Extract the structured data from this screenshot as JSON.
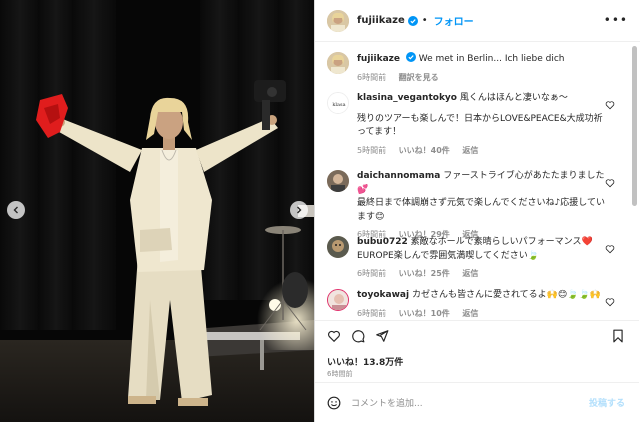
{
  "post": {
    "username": "fujiikaze",
    "separator": "•",
    "follow_label": "フォロー",
    "more_label": "•••",
    "caption": "We met in Berlin... Ich liebe dich",
    "caption_time": "6時間前",
    "see_translation": "翻訳を見る"
  },
  "comments": [
    {
      "username": "klasina_vegantokyo",
      "text_line1": "風くんはほんと凄いなぁ〜",
      "text_rest": "残りのツアーも楽しんで！日本からLOVE&PEACE&大成功祈ってます！",
      "time": "5時間前",
      "likes": "いいね！40件",
      "reply": "返信",
      "avatar_text": "klasa"
    },
    {
      "username": "daichannomama",
      "text_line1": "ファーストライブ心があたたまりました💕",
      "text_rest": "最終日まで体調崩さず元気で楽しんでくださいね♪応援しています😊",
      "time": "6時間前",
      "likes": "いいね！29件",
      "reply": "返信"
    },
    {
      "username": "bubu0722",
      "text_line1": "素敵なホールで素晴らしいパフォーマンス❤️",
      "text_rest": "EUROPE楽しんで雰囲気満喫してください🍃",
      "time": "6時間前",
      "likes": "いいね！25件",
      "reply": "返信"
    },
    {
      "username": "toyokawaj",
      "text_line1": "カゼさんも皆さんに愛されてるよ🙌😊🍃🍃🙌",
      "text_rest": "",
      "time": "6時間前",
      "likes": "いいね！10件",
      "reply": "返信"
    }
  ],
  "actions": {
    "likes": "いいね！13.8万件",
    "time": "6時間前",
    "icons": [
      "heart-icon",
      "comment-icon",
      "share-icon",
      "bookmark-icon"
    ]
  },
  "compose": {
    "placeholder": "コメントを追加...",
    "post_label": "投稿する"
  },
  "colors": {
    "link": "#0095f6",
    "muted": "#8e8e8e",
    "heart": "#ed4956"
  }
}
